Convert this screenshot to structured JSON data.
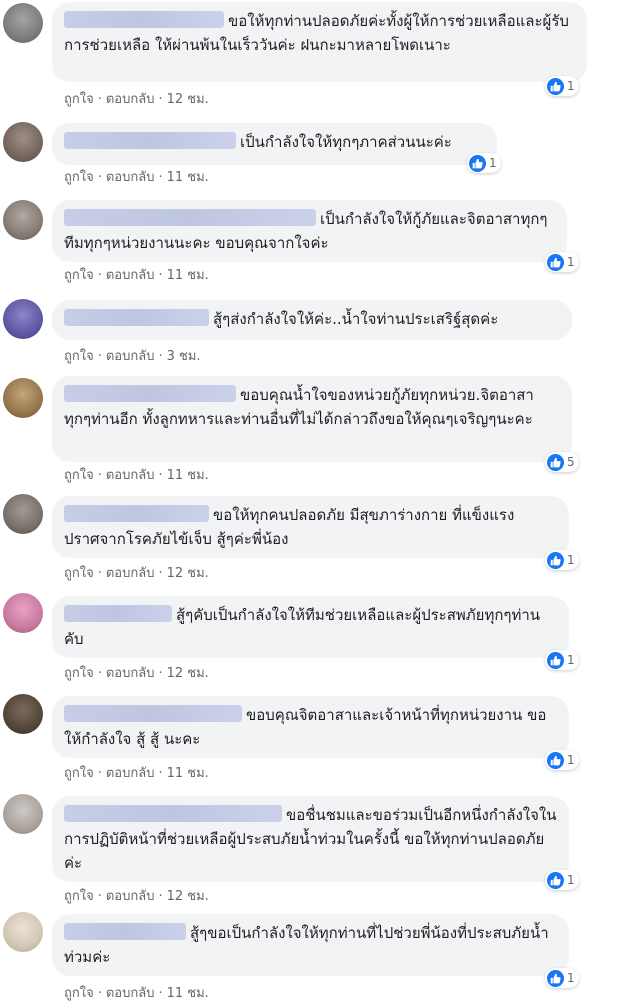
{
  "ui": {
    "like_label": "ถูกใจ",
    "reply_label": "ตอบกลับ",
    "separator": "·"
  },
  "comments": [
    {
      "text": "ขอให้ทุกท่านปลอดภัยค่ะทั้งผู้ให้การช่วยเหลือและผู้รับการช่วยเหลือ ให้ผ่านพ้นในเร็ววันค่ะ ฝนกะมาหลายโพดเนาะ",
      "time": "12 ชม.",
      "reactions": "1"
    },
    {
      "text": "เป็นกำลังใจให้ทุกๆภาคส่วนนะค่ะ",
      "time": "11 ชม.",
      "reactions": "1"
    },
    {
      "text": "เป็นกำลังใจให้กู้ภัยและจิตอาสาทุกๆทีมทุกๆหน่วยงานนะคะ ขอบคุณจากใจค่ะ",
      "time": "11 ชม.",
      "reactions": "1"
    },
    {
      "text": "สู้ๆส่งกำลังใจให้ค่ะ..น้ำใจท่านประเสริฐ์สุดค่ะ",
      "time": "3 ชม.",
      "reactions": ""
    },
    {
      "text": "ขอบคุณน้ำใจของหน่วยกู้ภัยทุกหน่วย.จิตอาสาทุกๆท่านอีก ทั้งลูกทหารและท่านอื่นที่ไม่ได้กล่าวถึงขอให้คุณๆเจริญๆนะคะ",
      "time": "11 ชม.",
      "reactions": "5"
    },
    {
      "text": "ขอให้ทุกคนปลอดภัย มีสุขภาร่างกาย ที่แข็งแรงปราศจากโรคภัยไข้เจ็บ สู้ๆค่ะพี่น้อง",
      "time": "12 ชม.",
      "reactions": "1"
    },
    {
      "text": "สู้ๆคับเป็นกำลังใจให้ทีมช่วยเหลือและผู้ประสพภัยทุกๆท่านคับ",
      "time": "12 ชม.",
      "reactions": "1"
    },
    {
      "text": "ขอบคุณจิตอาสาและเจ้าหน้าที่ทุกหน่วยงาน ขอให้กำลังใจ สู้ สู้ นะคะ",
      "time": "11 ชม.",
      "reactions": "1"
    },
    {
      "text": "ขอชื่นชมและขอร่วมเป็นอีกหนึ่งกำลังใจในการปฏิบัติหน้าที่ช่วยเหลือผู้ประสบภัยน้ำท่วมในครั้งนี้ ขอให้ทุกท่านปลอดภัยค่ะ",
      "time": "12 ชม.",
      "reactions": "1"
    },
    {
      "text": "สู้ๆขอเป็นกำลังใจให้ทุกท่านที่ไปช่วยพี่น้องที่ประสบภัยน้ำท่วมค่ะ",
      "time": "11 ชม.",
      "reactions": "1"
    }
  ],
  "colors": {
    "bubble": "#f2f3f5",
    "like_blue": "#1877f2",
    "meta_text": "#606770"
  },
  "icons": {
    "like": "thumbs-up-icon"
  }
}
